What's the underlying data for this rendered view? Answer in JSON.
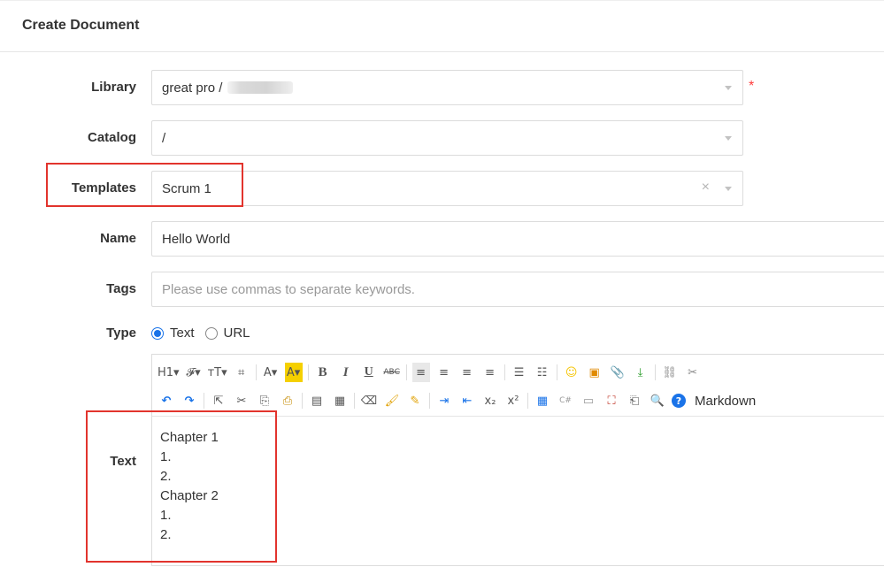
{
  "header": {
    "title": "Create Document"
  },
  "form": {
    "library": {
      "label": "Library",
      "value": "great pro /"
    },
    "catalog": {
      "label": "Catalog",
      "value": "/"
    },
    "templates": {
      "label": "Templates",
      "value": "Scrum 1",
      "clear": "×"
    },
    "name": {
      "label": "Name",
      "value": "Hello World"
    },
    "tags": {
      "label": "Tags",
      "placeholder": "Please use commas to separate keywords."
    },
    "type": {
      "label": "Type",
      "options": [
        "Text",
        "URL"
      ],
      "selected": "Text"
    },
    "text": {
      "label": "Text"
    },
    "required_mark": "*"
  },
  "toolbar": {
    "row1": [
      "H1▾",
      "𝓕▾",
      "тT▾",
      "⌗",
      "A▾",
      "A▾",
      "B",
      "I",
      "U",
      "ABC",
      "≡",
      "≡",
      "≡",
      "≡",
      "☰",
      "☷",
      "☺",
      "▣",
      "📎",
      "⤓",
      "⛓",
      "✂"
    ],
    "row2": [
      "↶",
      "↷",
      "⇱",
      "✂",
      "⎘",
      "⎙",
      "▤",
      "▦",
      "⌫",
      "🖌",
      "✎",
      "⇥",
      "⇤",
      "x₂",
      "x²",
      "▦",
      "C#",
      "▭",
      "⛶",
      "⎗",
      "🔍",
      "?"
    ],
    "markdown_label": "Markdown",
    "colors": {
      "font_highlight": "#f5d000",
      "smile": "#f5c400",
      "blue": "#1a73e8"
    }
  },
  "editor": {
    "lines": [
      "Chapter 1",
      "1.",
      "2.",
      "Chapter 2",
      "1.",
      "2."
    ]
  },
  "colors": {
    "accent": "#1a73e8",
    "annotation": "#e2342d",
    "required": "#ff3b3b"
  }
}
